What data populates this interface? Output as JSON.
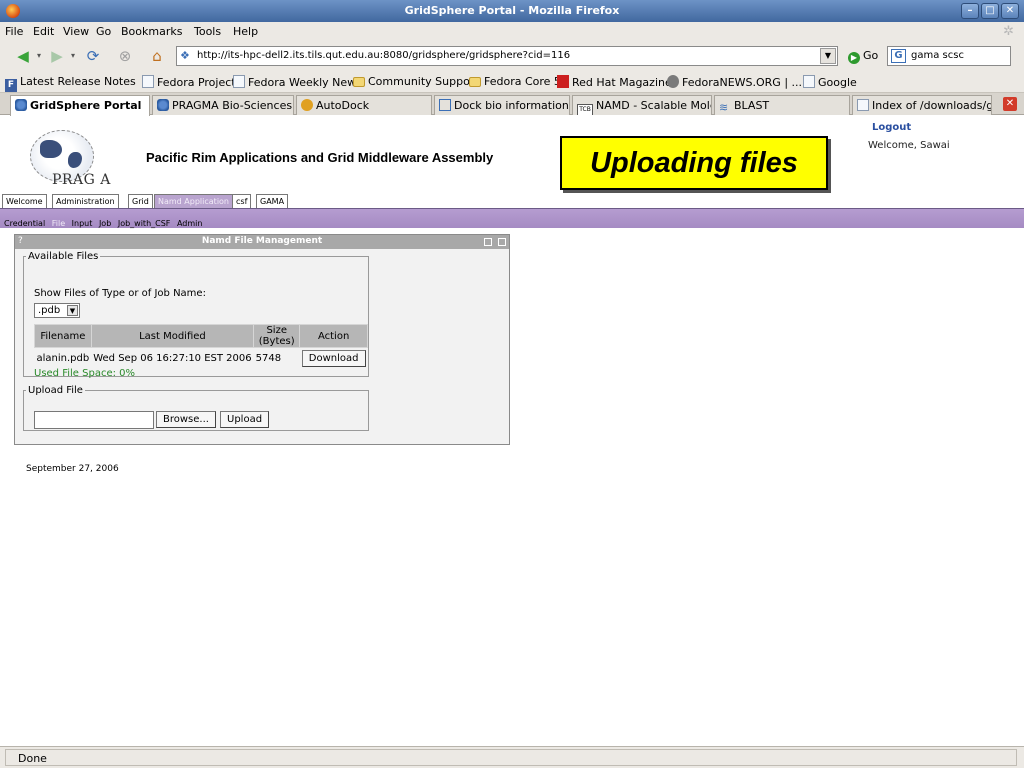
{
  "window": {
    "title": "GridSphere Portal - Mozilla Firefox"
  },
  "menu": [
    "File",
    "Edit",
    "View",
    "Go",
    "Bookmarks",
    "Tools",
    "Help"
  ],
  "nav": {
    "url": "http://its-hpc-dell2.its.tils.qut.edu.au:8080/gridsphere/gridsphere?cid=116",
    "go_label": "Go",
    "search_value": "gama scsc"
  },
  "bookmarks": [
    {
      "label": "Latest Release Notes",
      "icon": "release-notes-icon"
    },
    {
      "label": "Fedora Project",
      "icon": "page-icon"
    },
    {
      "label": "Fedora Weekly News",
      "icon": "page-icon"
    },
    {
      "label": "Community Support",
      "icon": "folder-icon"
    },
    {
      "label": "Fedora Core 5",
      "icon": "folder-icon"
    },
    {
      "label": "Red Hat Magazine",
      "icon": "redhat-icon"
    },
    {
      "label": "FedoraNEWS.ORG | ....",
      "icon": "fedoranews-icon"
    },
    {
      "label": "Google",
      "icon": "page-icon"
    }
  ],
  "tabs": [
    {
      "label": "GridSphere Portal",
      "active": true
    },
    {
      "label": "PRAGMA Bio-Sciences..."
    },
    {
      "label": "AutoDock"
    },
    {
      "label": "Dock bio information - ..."
    },
    {
      "label": "NAMD - Scalable Mole..."
    },
    {
      "label": "BLAST"
    },
    {
      "label": "Index of /downloads/ga..."
    }
  ],
  "page": {
    "logo_text": "PRAG A",
    "site_title": "Pacific Rim Applications and Grid Middleware Assembly",
    "banner": "Uploading files",
    "logout": "Logout",
    "welcome": "Welcome, Sawai",
    "portal_tabs": [
      "Welcome",
      "Administration",
      "Grid",
      "Namd Application",
      "csf",
      "GAMA"
    ],
    "subnav": [
      "Credential",
      "File",
      "Input",
      "Job",
      "Job_with_CSF",
      "Admin"
    ],
    "portlet": {
      "title": "Namd File Management",
      "help": "?",
      "available_legend": "Available Files",
      "show_label": "Show Files of Type or of Job Name:",
      "filter_value": ".pdb",
      "columns": [
        "Filename",
        "Last Modified",
        "Size (Bytes)",
        "Action"
      ],
      "rows": [
        {
          "filename": "alanin.pdb",
          "modified": "Wed Sep 06 16:27:10 EST 2006",
          "size": "5748",
          "action": "Download"
        }
      ],
      "used_space": "Used File Space: 0%",
      "upload_legend": "Upload File",
      "browse": "Browse...",
      "upload": "Upload"
    },
    "date": "September 27, 2006"
  },
  "status": "Done",
  "colors": {
    "titlebar": "#4f78ae",
    "banner": "#ffff00",
    "purple_nav": "#ac93c9",
    "used_space": "#2a8a2a"
  }
}
